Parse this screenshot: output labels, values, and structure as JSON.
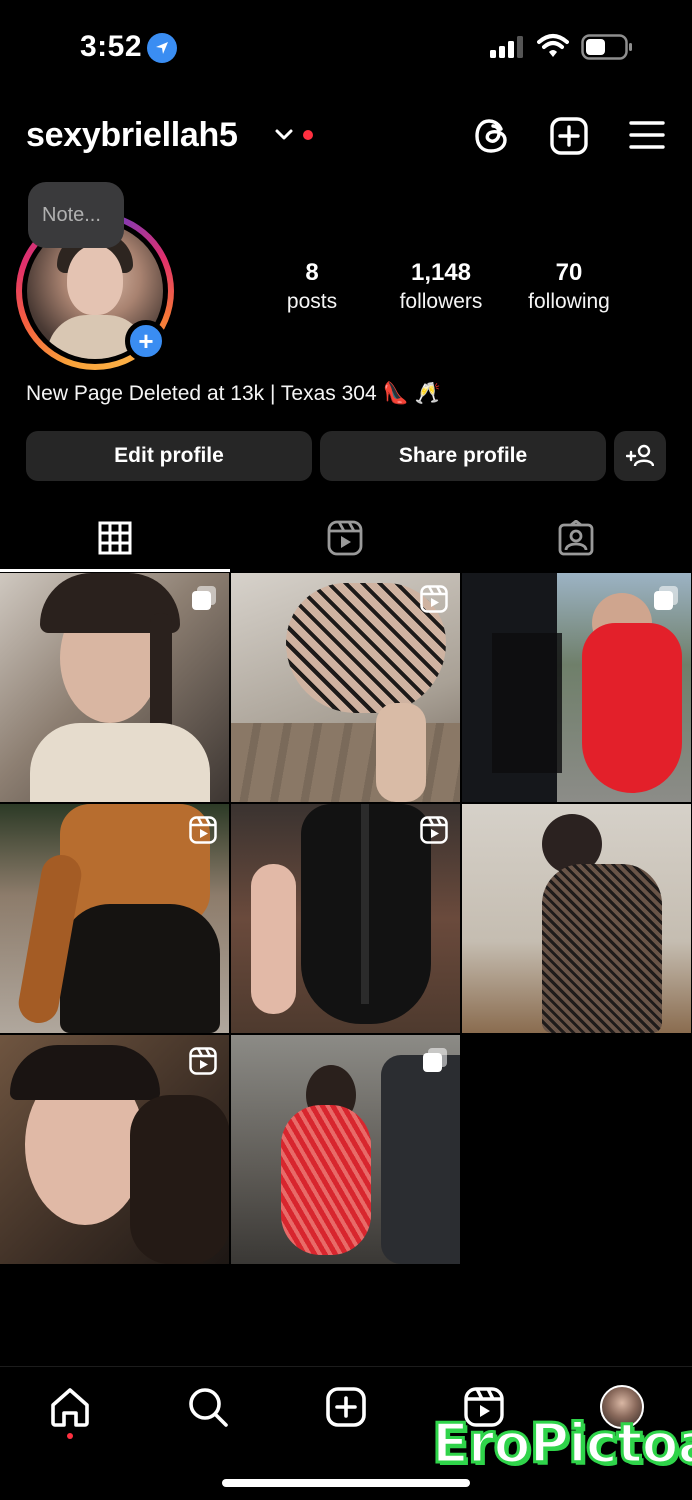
{
  "status_bar": {
    "time": "3:52",
    "icons": [
      "location-icon",
      "signal-icon",
      "wifi-icon",
      "battery-icon"
    ]
  },
  "header": {
    "username": "sexybriellah5",
    "icons": [
      "chevron-down-icon",
      "threads-icon",
      "create-post-icon",
      "menu-icon"
    ]
  },
  "note": {
    "placeholder": "Note..."
  },
  "stats": [
    {
      "value": "8",
      "label": "posts"
    },
    {
      "value": "1,148",
      "label": "followers"
    },
    {
      "value": "70",
      "label": "following"
    }
  ],
  "bio": "New Page Deleted at 13k | Texas 304 👠 🥂",
  "buttons": {
    "edit": "Edit profile",
    "share": "Share profile"
  },
  "tabs": [
    "grid-icon",
    "reels-icon",
    "tagged-icon"
  ],
  "posts": [
    {
      "type": "carousel",
      "badge": "carousel-icon"
    },
    {
      "type": "reel",
      "badge": "reel-icon"
    },
    {
      "type": "carousel",
      "badge": "carousel-icon"
    },
    {
      "type": "reel",
      "badge": "reel-icon"
    },
    {
      "type": "reel",
      "badge": "reel-icon"
    },
    {
      "type": "photo",
      "badge": ""
    },
    {
      "type": "reel",
      "badge": "reel-icon"
    },
    {
      "type": "carousel",
      "badge": "carousel-icon"
    }
  ],
  "bottom_nav": [
    "home-icon",
    "search-icon",
    "create-icon",
    "reels-icon",
    "profile-avatar"
  ],
  "watermark": "EroPictoa",
  "colors": {
    "background": "#000000",
    "button": "#262626",
    "accent_blue": "#3a8df2",
    "notification_red": "#ff3040",
    "watermark_green": "#2fd44a"
  }
}
